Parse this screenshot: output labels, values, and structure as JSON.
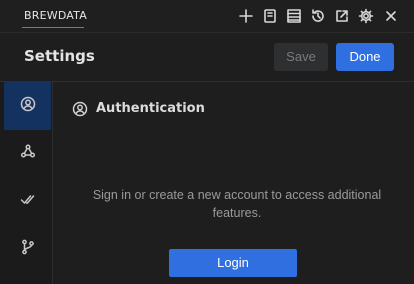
{
  "app": {
    "tab_label": "BREWDATA"
  },
  "toolbar": {
    "icons": [
      "plus-icon",
      "notebook-icon",
      "list-icon",
      "history-icon",
      "open-external-icon",
      "gear-icon",
      "close-icon"
    ]
  },
  "header": {
    "title": "Settings",
    "save_label": "Save",
    "done_label": "Done"
  },
  "sidebar": {
    "items": [
      {
        "icon": "user-circle-icon",
        "active": true
      },
      {
        "icon": "webhook-icon",
        "active": false
      },
      {
        "icon": "double-check-icon",
        "active": false
      },
      {
        "icon": "git-branch-icon",
        "active": false
      }
    ]
  },
  "main": {
    "section_title": "Authentication",
    "message": "Sign in or create a new account to access additional features.",
    "login_label": "Login"
  },
  "colors": {
    "accent": "#2f6fe0",
    "active_sidebar": "#14325f",
    "background": "#1e1e1f"
  }
}
